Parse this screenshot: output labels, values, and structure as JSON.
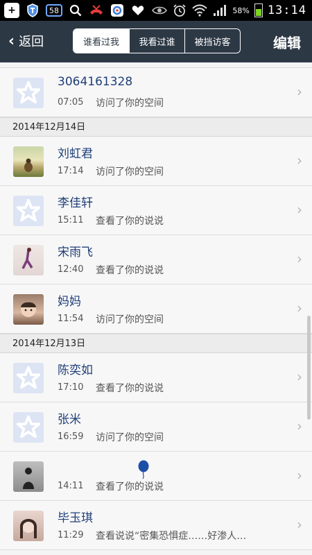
{
  "statusbar": {
    "icons": [
      "plus-icon",
      "shield-icon",
      "badge-58-icon",
      "search-icon",
      "missed-call-icon",
      "app-icon",
      "heart-icon"
    ],
    "badge_count": "58",
    "battery_percent": "58%",
    "time": "13:14"
  },
  "header": {
    "back_label": "返回",
    "tabs": [
      {
        "label": "谁看过我",
        "active": true
      },
      {
        "label": "我看过谁",
        "active": false
      },
      {
        "label": "被挡访客",
        "active": false
      }
    ],
    "edit_label": "编辑"
  },
  "list": {
    "first_row": {
      "name": "3064161328",
      "time": "07:05",
      "action": "访问了你的空间"
    },
    "sections": [
      {
        "date": "2014年12月14日",
        "rows": [
          {
            "name": "刘虹君",
            "time": "17:14",
            "action": "访问了你的空间",
            "avatar": "photo"
          },
          {
            "name": "李佳轩",
            "time": "15:11",
            "action": "查看了你的说说",
            "avatar": "default"
          },
          {
            "name": "宋雨飞",
            "time": "12:40",
            "action": "查看了你的说说",
            "avatar": "photo"
          },
          {
            "name": "妈妈",
            "time": "11:54",
            "action": "访问了你的空间",
            "avatar": "photo"
          }
        ]
      },
      {
        "date": "2014年12月13日",
        "rows": [
          {
            "name": "陈奕如",
            "time": "17:10",
            "action": "查看了你的说说",
            "avatar": "default"
          },
          {
            "name": "张米",
            "time": "16:59",
            "action": "访问了你的空间",
            "avatar": "default"
          },
          {
            "name": "",
            "time": "14:11",
            "action": "查看了你的说说",
            "avatar": "photo"
          },
          {
            "name": "毕玉琪",
            "time": "11:29",
            "action": "查看说说“密集恐惧症……好渗人…",
            "avatar": "photo"
          }
        ]
      }
    ]
  },
  "colors": {
    "header_bg": "#2d3845",
    "name_color": "#1f3f78",
    "default_avatar_bg": "#dde4f4",
    "balloon": "#1d4fa8"
  }
}
